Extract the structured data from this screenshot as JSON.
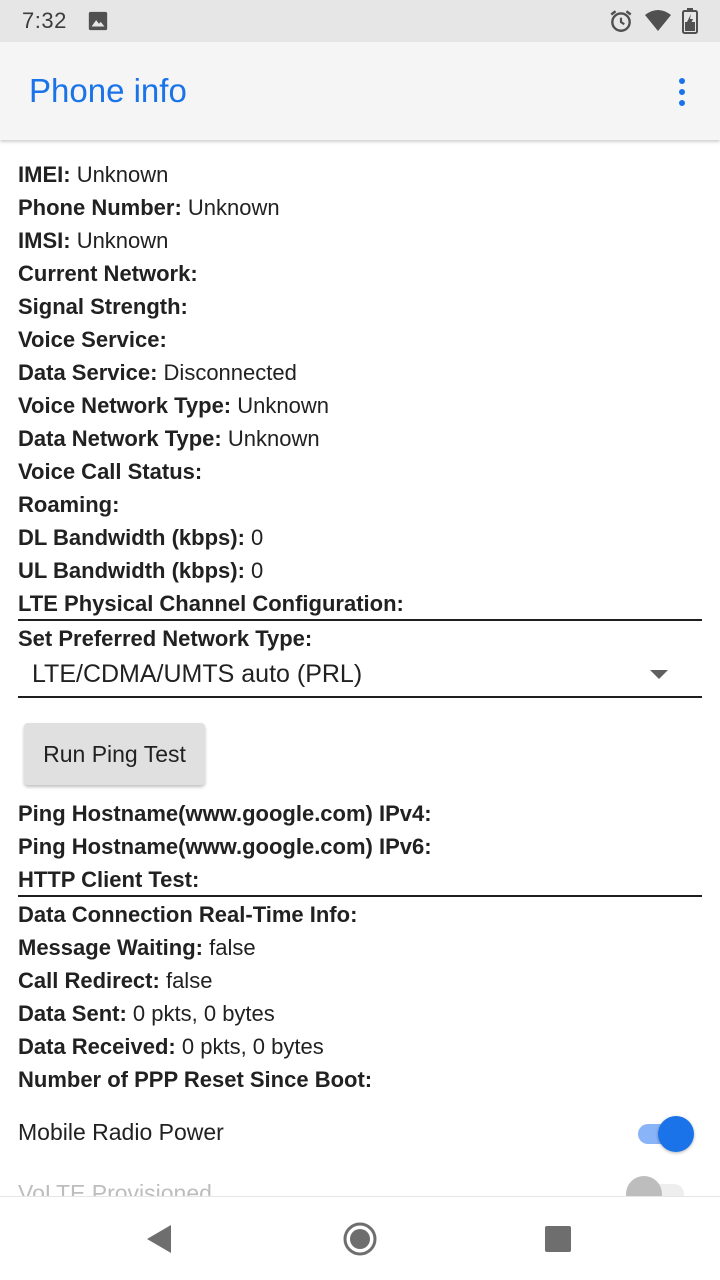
{
  "status_bar": {
    "time": "7:32",
    "icons": [
      "image-icon",
      "alarm-icon",
      "wifi-icon",
      "battery-icon"
    ]
  },
  "app_bar": {
    "title": "Phone info",
    "menu_icon": "more-vert-icon"
  },
  "info": {
    "imei_label": "IMEI:",
    "imei_value": "Unknown",
    "phone_number_label": "Phone Number:",
    "phone_number_value": "Unknown",
    "imsi_label": "IMSI:",
    "imsi_value": "Unknown",
    "current_network_label": "Current Network:",
    "signal_strength_label": "Signal Strength:",
    "voice_service_label": "Voice Service:",
    "data_service_label": "Data Service:",
    "data_service_value": "Disconnected",
    "voice_network_type_label": "Voice Network Type:",
    "voice_network_type_value": "Unknown",
    "data_network_type_label": "Data Network Type:",
    "data_network_type_value": "Unknown",
    "voice_call_status_label": "Voice Call Status:",
    "roaming_label": "Roaming:",
    "dl_bandwidth_label": "DL Bandwidth (kbps):",
    "dl_bandwidth_value": "0",
    "ul_bandwidth_label": "UL Bandwidth (kbps):",
    "ul_bandwidth_value": "0",
    "lte_config_label": "LTE Physical Channel Configuration:"
  },
  "network_type": {
    "label": "Set Preferred Network Type:",
    "selected": "LTE/CDMA/UMTS auto (PRL)"
  },
  "ping": {
    "button_label": "Run Ping Test",
    "ipv4_label": "Ping Hostname(www.google.com) IPv4:",
    "ipv6_label": "Ping Hostname(www.google.com) IPv6:",
    "http_label": "HTTP Client Test:"
  },
  "connection": {
    "realtime_label": "Data Connection Real-Time Info:",
    "message_waiting_label": "Message Waiting:",
    "message_waiting_value": "false",
    "call_redirect_label": "Call Redirect:",
    "call_redirect_value": "false",
    "data_sent_label": "Data Sent:",
    "data_sent_value": "0 pkts, 0 bytes",
    "data_received_label": "Data Received:",
    "data_received_value": "0 pkts, 0 bytes",
    "ppp_reset_label": "Number of PPP Reset Since Boot:"
  },
  "toggles": {
    "mobile_radio_label": "Mobile Radio Power",
    "mobile_radio_on": true,
    "volte_label": "VoLTE Provisioned",
    "volte_on": false
  },
  "colors": {
    "accent": "#1a73e8",
    "track_on": "#8ab4f8",
    "thumb_off": "#bdbdbd",
    "track_off": "#e0e0e0"
  },
  "nav_bar": {
    "icons": [
      "back-icon",
      "home-icon",
      "recents-icon"
    ]
  }
}
